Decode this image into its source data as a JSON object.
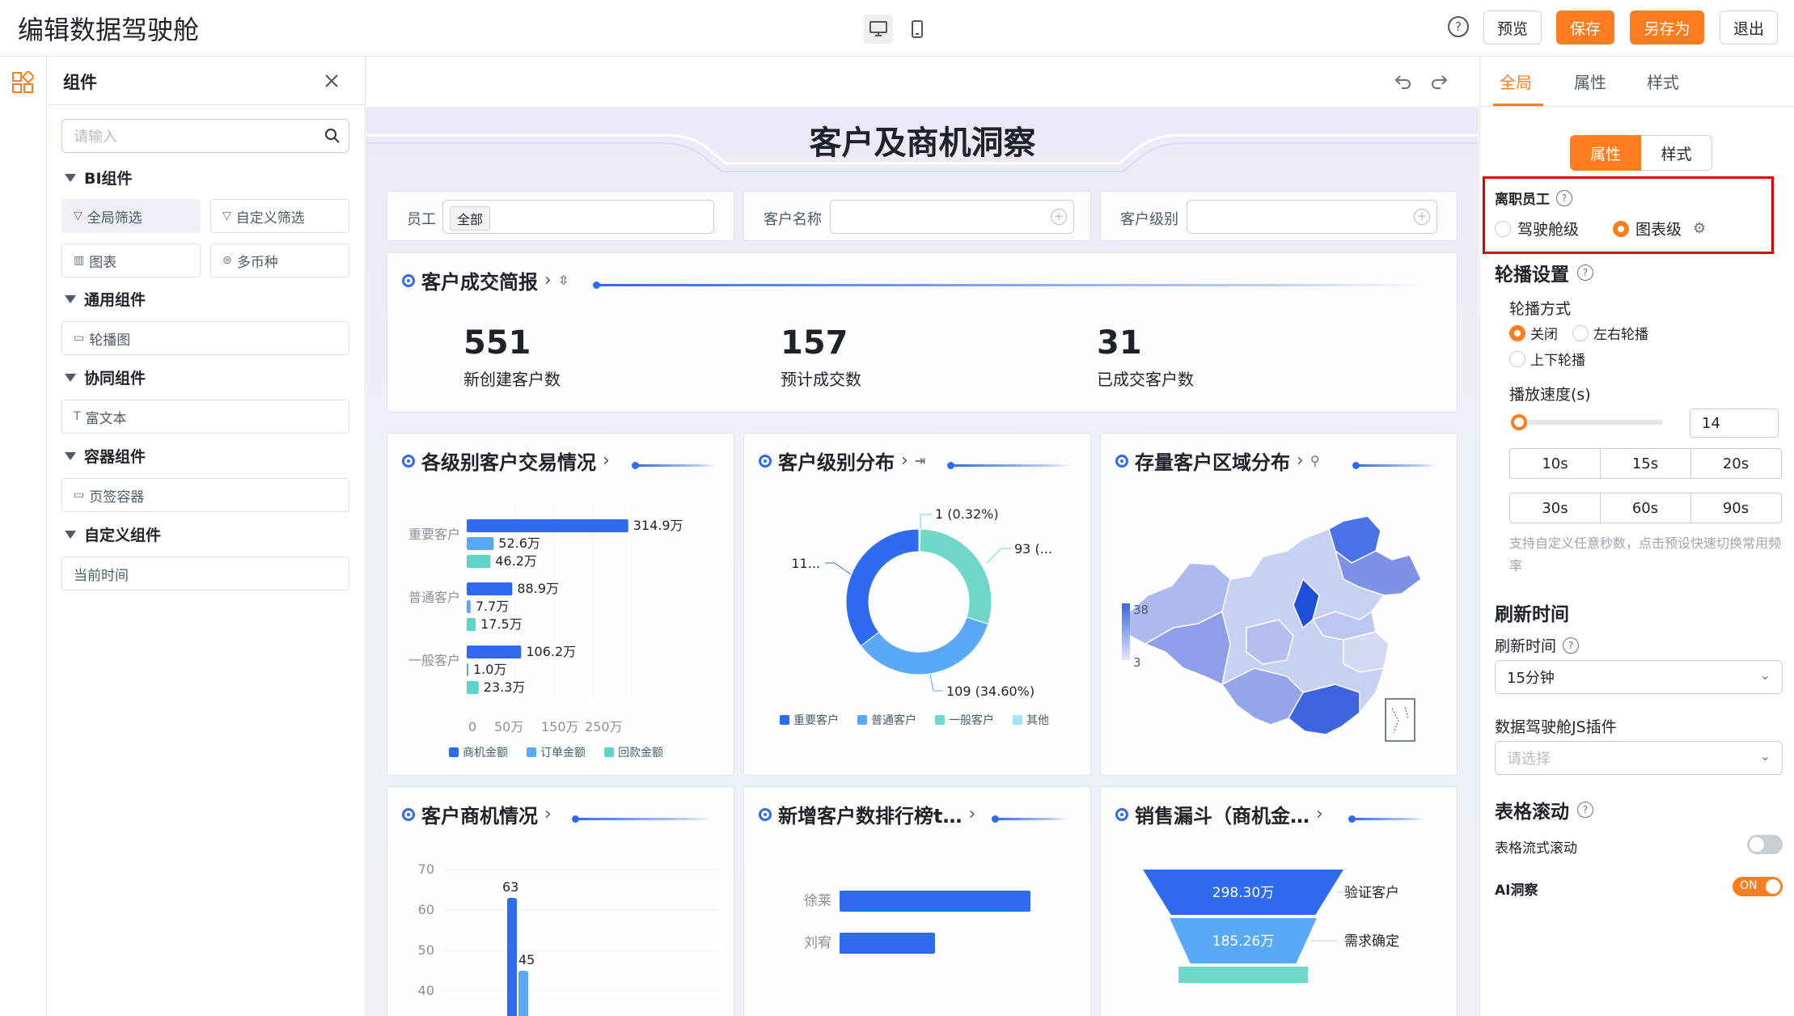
{
  "app": {
    "title": "编辑数据驾驶舱"
  },
  "toolbar": {
    "help": "?",
    "preview": "预览",
    "save": "保存",
    "save_as": "另存为",
    "exit": "退出"
  },
  "components_panel": {
    "title": "组件",
    "search_placeholder": "请输入",
    "groups": [
      {
        "label": "BI组件",
        "items": [
          "全局筛选",
          "自定义筛选",
          "图表",
          "多币种"
        ]
      },
      {
        "label": "通用组件",
        "items": [
          "轮播图"
        ]
      },
      {
        "label": "协同组件",
        "items": [
          "富文本"
        ]
      },
      {
        "label": "容器组件",
        "items": [
          "页签容器"
        ]
      },
      {
        "label": "自定义组件",
        "items": [
          "当前时间"
        ]
      }
    ]
  },
  "dashboard": {
    "title": "客户及商机洞察",
    "filters": [
      {
        "label": "员工",
        "value": "全部"
      },
      {
        "label": "客户名称",
        "value": ""
      },
      {
        "label": "客户级别",
        "value": ""
      }
    ],
    "brief": {
      "title": "客户成交简报",
      "kpis": [
        {
          "value": "551",
          "label": "新创建客户数"
        },
        {
          "value": "157",
          "label": "预计成交数"
        },
        {
          "value": "31",
          "label": "已成交客户数"
        }
      ]
    },
    "cards": {
      "trade": "各级别客户交易情况",
      "level": "客户级别分布",
      "region": "存量客户区域分布",
      "opps": "客户商机情况",
      "ranking": "新增客户数排行榜t…",
      "funnel": "销售漏斗（商机金…"
    }
  },
  "chart_data": [
    {
      "type": "bar",
      "title": "各级别客户交易情况",
      "orientation": "horizontal",
      "categories": [
        "重要客户",
        "普通客户",
        "一般客户"
      ],
      "series": [
        {
          "name": "商机金额",
          "values": [
            314.9,
            88.9,
            106.2
          ],
          "labels": [
            "314.9万",
            "88.9万",
            "106.2万"
          ],
          "color": "#2f6bf0"
        },
        {
          "name": "订单金额",
          "values": [
            52.6,
            7.7,
            1.0
          ],
          "labels": [
            "52.6万",
            "7.7万",
            "1.0万"
          ],
          "color": "#5aa9f7"
        },
        {
          "name": "回款金额",
          "values": [
            46.2,
            17.5,
            23.3
          ],
          "labels": [
            "46.2万",
            "17.5万",
            "23.3万"
          ],
          "color": "#5ed4c6"
        }
      ],
      "x_ticks": [
        "0",
        "50万",
        "150万",
        "250万"
      ],
      "xlim": [
        0,
        350
      ]
    },
    {
      "type": "pie",
      "title": "客户级别分布",
      "donut": true,
      "slices": [
        {
          "name": "重要客户",
          "value": 111,
          "label": "11...",
          "color": "#2f6bf0"
        },
        {
          "name": "普通客户",
          "value": 109,
          "label": "109 (34.60%)",
          "color": "#5aa9f7"
        },
        {
          "name": "一般客户",
          "value": 93,
          "label": "93 (...",
          "color": "#6fd8c8"
        },
        {
          "name": "其他",
          "value": 1,
          "label": "1 (0.32%)",
          "color": "#a5e5f0"
        }
      ]
    },
    {
      "type": "map",
      "title": "存量客户区域分布",
      "legend": {
        "max": "38",
        "min": "3"
      }
    },
    {
      "type": "bar",
      "title": "客户商机情况",
      "y_ticks": [
        "70",
        "60",
        "50",
        "40"
      ],
      "ylim": [
        40,
        70
      ],
      "series": [
        {
          "name": "",
          "values": [
            63
          ],
          "labels": [
            "63"
          ],
          "color": "#2f6bf0"
        },
        {
          "name": "",
          "values": [
            45
          ],
          "labels": [
            "45"
          ],
          "color": "#5aa9f7"
        }
      ]
    },
    {
      "type": "bar",
      "title": "新增客户数排行榜t…",
      "orientation": "horizontal",
      "categories": [
        "徐莱",
        "刘宥"
      ],
      "values": [
        1.0,
        0.5
      ]
    },
    {
      "type": "funnel",
      "title": "销售漏斗（商机金…",
      "stages": [
        {
          "name": "验证客户",
          "value": 298.3,
          "label": "298.30万"
        },
        {
          "name": "需求确定",
          "value": 185.26,
          "label": "185.26万"
        }
      ]
    }
  ],
  "props_panel": {
    "tabs": [
      "全局",
      "属性",
      "样式"
    ],
    "active_tab": "全局",
    "segments": [
      "属性",
      "样式"
    ],
    "active_segment": "属性",
    "resigned": {
      "label": "离职员工",
      "options": [
        "驾驶舱级",
        "图表级"
      ],
      "selected": "图表级"
    },
    "carousel": {
      "heading": "轮播设置",
      "mode_label": "轮播方式",
      "modes": [
        "关闭",
        "左右轮播",
        "上下轮播"
      ],
      "selected": "关闭",
      "speed_label": "播放速度(s)",
      "speed_value": "14",
      "presets": [
        "10s",
        "15s",
        "20s",
        "30s",
        "60s",
        "90s"
      ],
      "hint": "支持自定义任意秒数，点击预设快速切换常用频率"
    },
    "refresh": {
      "heading": "刷新时间",
      "label": "刷新时间",
      "value": "15分钟"
    },
    "plugin": {
      "label": "数据驾驶舱JS插件",
      "placeholder": "请选择"
    },
    "table_scroll": {
      "heading": "表格滚动",
      "label": "表格流式滚动",
      "on": false
    },
    "ai": {
      "label": "AI洞察",
      "on_text": "ON",
      "on": true
    },
    "accent": "#ff7d1f",
    "highlight": "#e50000"
  }
}
